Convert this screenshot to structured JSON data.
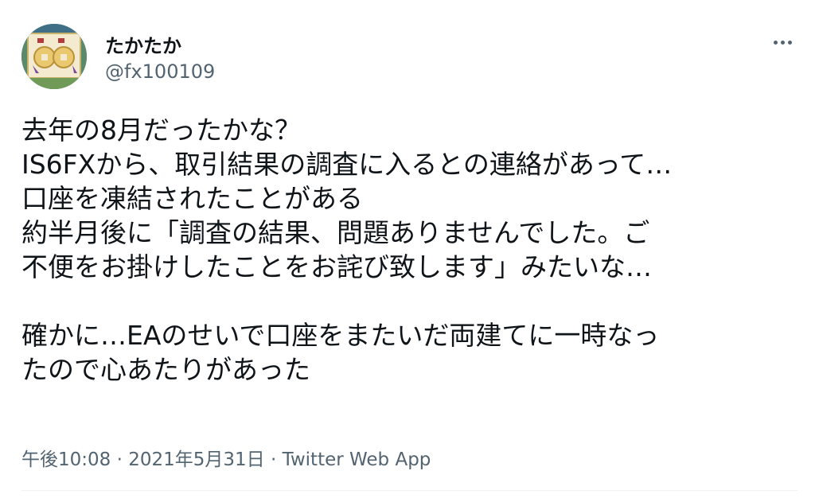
{
  "user": {
    "display_name": "たかたか",
    "handle": "@fx100109",
    "avatar_icon": "avatar-icon"
  },
  "menu": {
    "more_icon": "more-horizontal-icon"
  },
  "tweet": {
    "paragraphs": [
      [
        "去年の8月だったかな？",
        "IS6FXから、取引結果の調査に入るとの連絡があって…",
        "口座を凍結されたことがある",
        "約半月後に「調査の結果、問題ありませんでした。ご",
        "不便をお掛けしたことをお詫び致します」みたいな…"
      ],
      [
        "確かに…EAのせいで口座をまたいだ両建てに一時なっ",
        "たので心あたりがあった"
      ]
    ]
  },
  "meta": {
    "time": "午後10:08",
    "separator1": " · ",
    "date": "2021年5月31日",
    "separator2": " · ",
    "source": "Twitter Web App"
  },
  "colors": {
    "text_primary": "#0f1419",
    "text_secondary": "#536471",
    "divider": "#eff3f4"
  }
}
